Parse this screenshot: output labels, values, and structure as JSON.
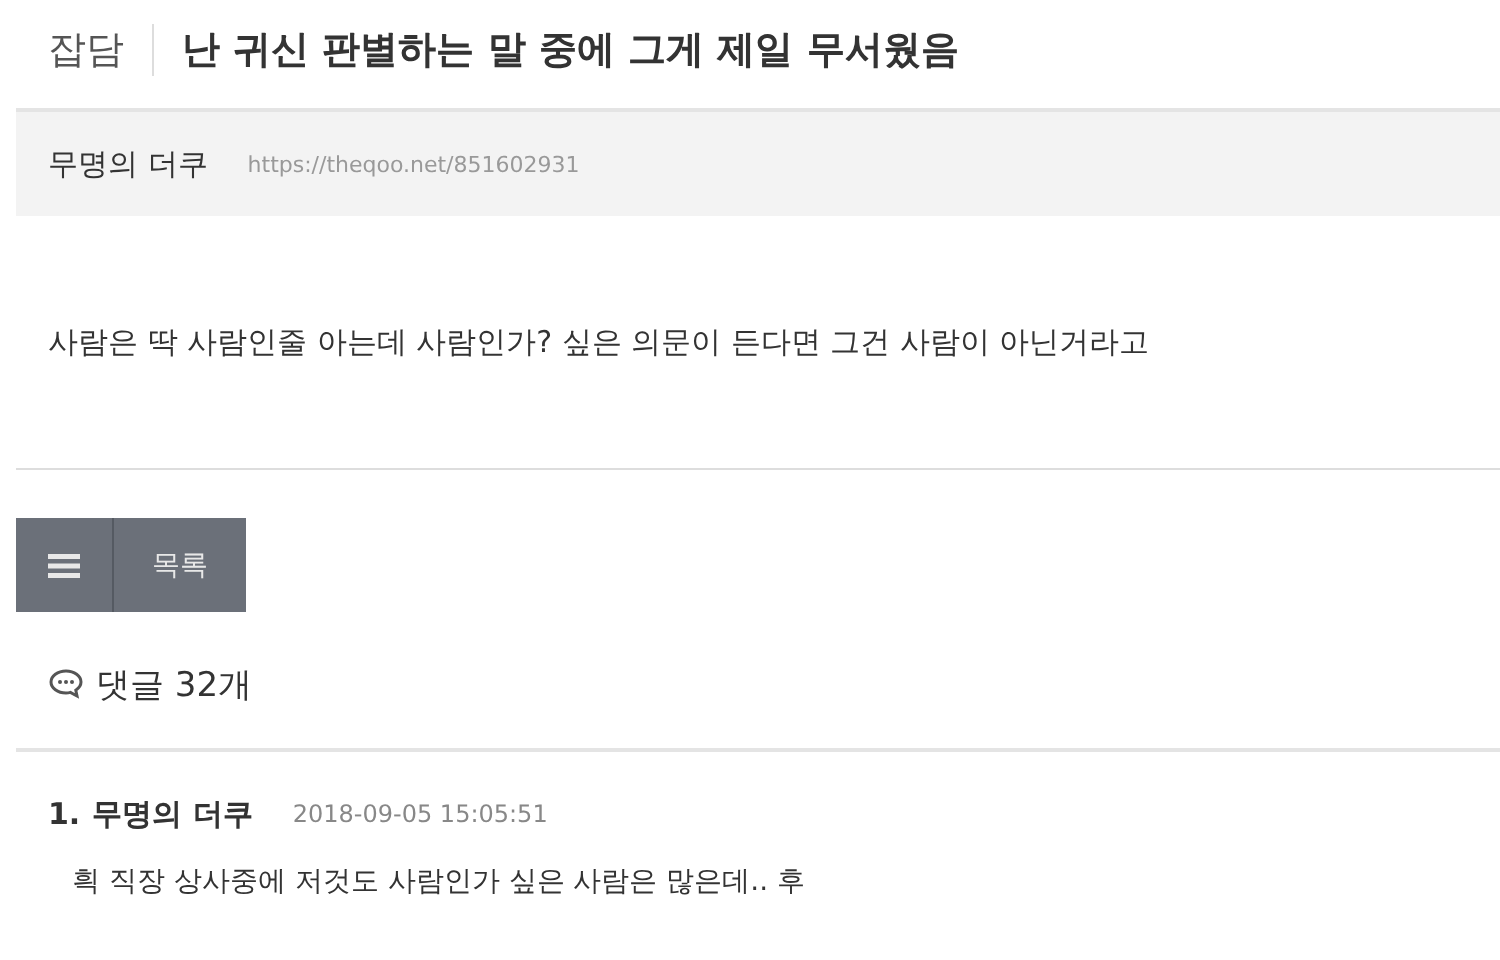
{
  "post": {
    "category": "잡담",
    "title": "난 귀신 판별하는 말 중에 그게 제일 무서웠음",
    "author": "무명의 더쿠",
    "url": "https://theqoo.net/851602931",
    "body": "사람은 딱 사람인줄 아는데 사람인가? 싶은 의문이 든다면 그건 사람이 아닌거라고"
  },
  "list_button": {
    "label": "목록"
  },
  "comments": {
    "count_label": "댓글 32개",
    "items": [
      {
        "number": "1.",
        "author": "무명의 더쿠",
        "time": "2018-09-05 15:05:51",
        "text": "흭 직장 상사중에 저것도 사람인가 싶은 사람은 많은데.. 후"
      }
    ]
  }
}
